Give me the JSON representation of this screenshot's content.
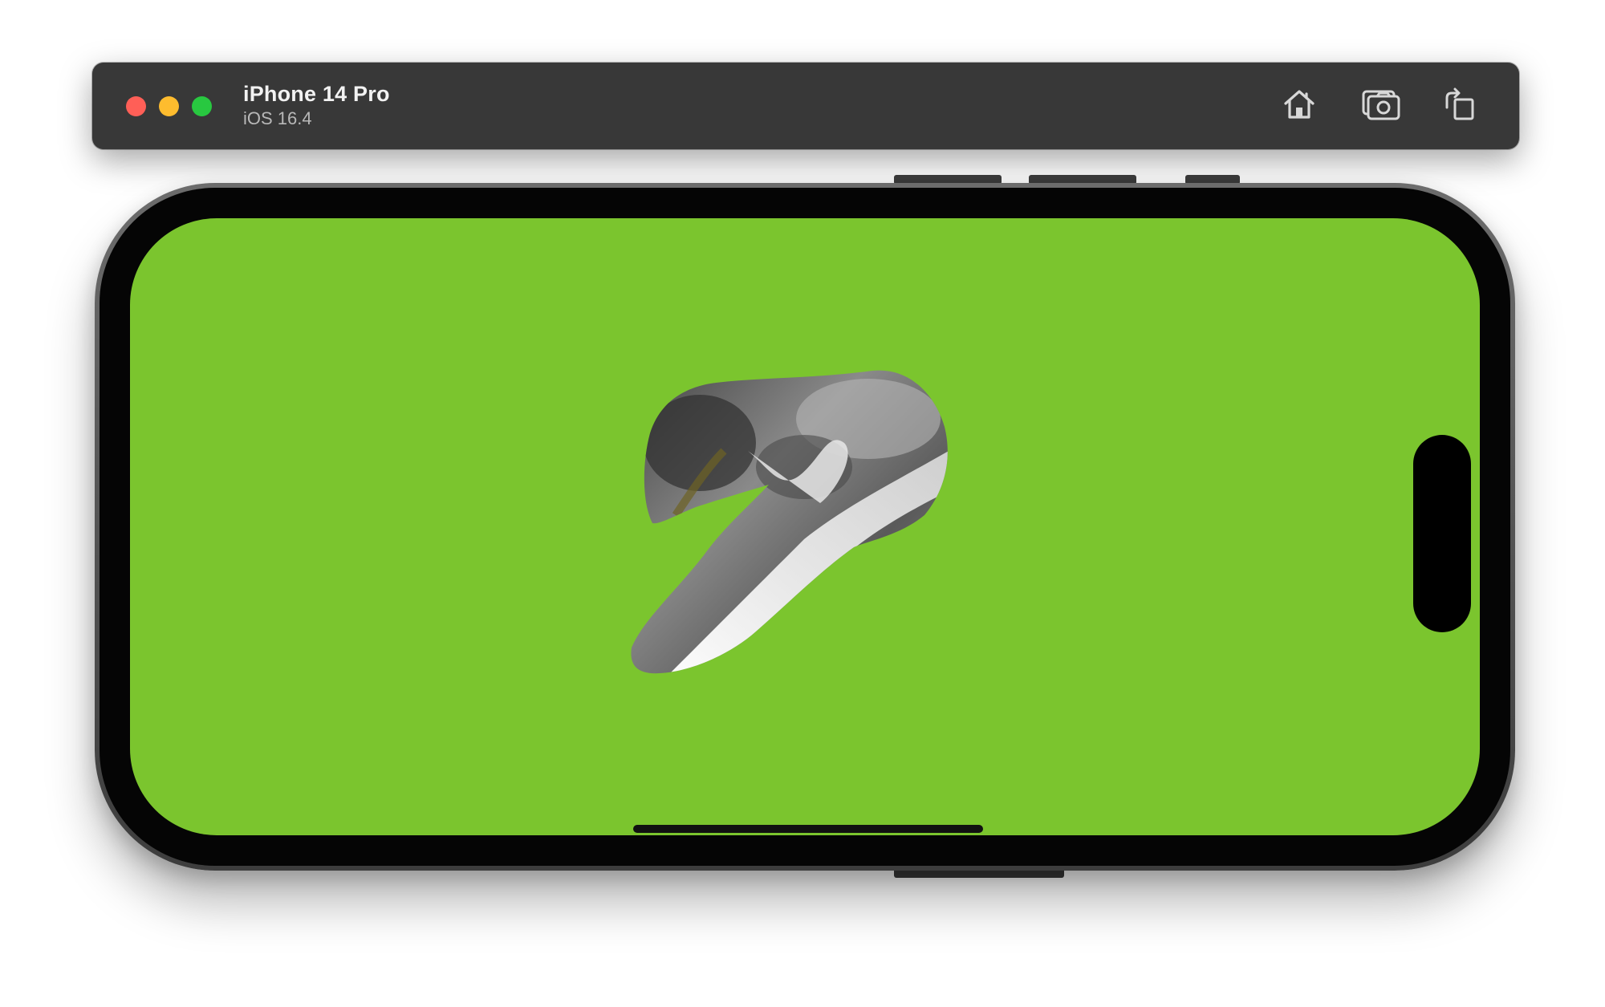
{
  "window": {
    "device_name": "iPhone 14 Pro",
    "os_version": "iOS 16.4"
  },
  "toolbar": {
    "buttons": [
      {
        "name": "home",
        "icon": "house-icon"
      },
      {
        "name": "screenshot",
        "icon": "camera-icon"
      },
      {
        "name": "rotate",
        "icon": "rotate-icon"
      }
    ]
  },
  "screen": {
    "background_color": "#7bc52e",
    "content": "masked-waterfall-image"
  }
}
